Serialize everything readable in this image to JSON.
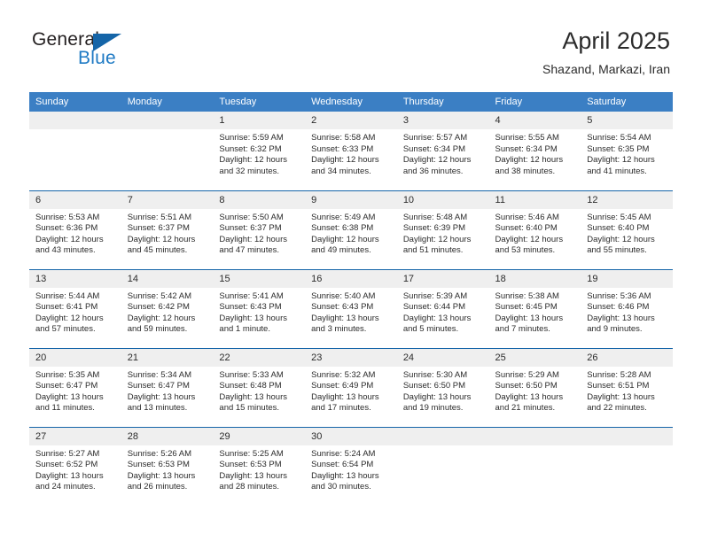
{
  "brand": {
    "name_part1": "General",
    "name_part2": "Blue",
    "triangle_color": "#1565a8",
    "blue_color": "#1f7ac4"
  },
  "header": {
    "title": "April 2025",
    "subtitle": "Shazand, Markazi, Iran"
  },
  "theme": {
    "header_row_bg": "#3b7fc4",
    "daynum_bg": "#efefef",
    "row_divider": "#1565a8",
    "text": "#2b2b2b"
  },
  "calendar": {
    "weekday_headers": [
      "Sunday",
      "Monday",
      "Tuesday",
      "Wednesday",
      "Thursday",
      "Friday",
      "Saturday"
    ],
    "weeks": [
      [
        {
          "day": "",
          "sunrise": "",
          "sunset": "",
          "daylight1": "",
          "daylight2": "",
          "blank": true
        },
        {
          "day": "",
          "sunrise": "",
          "sunset": "",
          "daylight1": "",
          "daylight2": "",
          "blank": true
        },
        {
          "day": "1",
          "sunrise": "Sunrise: 5:59 AM",
          "sunset": "Sunset: 6:32 PM",
          "daylight1": "Daylight: 12 hours",
          "daylight2": "and 32 minutes."
        },
        {
          "day": "2",
          "sunrise": "Sunrise: 5:58 AM",
          "sunset": "Sunset: 6:33 PM",
          "daylight1": "Daylight: 12 hours",
          "daylight2": "and 34 minutes."
        },
        {
          "day": "3",
          "sunrise": "Sunrise: 5:57 AM",
          "sunset": "Sunset: 6:34 PM",
          "daylight1": "Daylight: 12 hours",
          "daylight2": "and 36 minutes."
        },
        {
          "day": "4",
          "sunrise": "Sunrise: 5:55 AM",
          "sunset": "Sunset: 6:34 PM",
          "daylight1": "Daylight: 12 hours",
          "daylight2": "and 38 minutes."
        },
        {
          "day": "5",
          "sunrise": "Sunrise: 5:54 AM",
          "sunset": "Sunset: 6:35 PM",
          "daylight1": "Daylight: 12 hours",
          "daylight2": "and 41 minutes."
        }
      ],
      [
        {
          "day": "6",
          "sunrise": "Sunrise: 5:53 AM",
          "sunset": "Sunset: 6:36 PM",
          "daylight1": "Daylight: 12 hours",
          "daylight2": "and 43 minutes."
        },
        {
          "day": "7",
          "sunrise": "Sunrise: 5:51 AM",
          "sunset": "Sunset: 6:37 PM",
          "daylight1": "Daylight: 12 hours",
          "daylight2": "and 45 minutes."
        },
        {
          "day": "8",
          "sunrise": "Sunrise: 5:50 AM",
          "sunset": "Sunset: 6:37 PM",
          "daylight1": "Daylight: 12 hours",
          "daylight2": "and 47 minutes."
        },
        {
          "day": "9",
          "sunrise": "Sunrise: 5:49 AM",
          "sunset": "Sunset: 6:38 PM",
          "daylight1": "Daylight: 12 hours",
          "daylight2": "and 49 minutes."
        },
        {
          "day": "10",
          "sunrise": "Sunrise: 5:48 AM",
          "sunset": "Sunset: 6:39 PM",
          "daylight1": "Daylight: 12 hours",
          "daylight2": "and 51 minutes."
        },
        {
          "day": "11",
          "sunrise": "Sunrise: 5:46 AM",
          "sunset": "Sunset: 6:40 PM",
          "daylight1": "Daylight: 12 hours",
          "daylight2": "and 53 minutes."
        },
        {
          "day": "12",
          "sunrise": "Sunrise: 5:45 AM",
          "sunset": "Sunset: 6:40 PM",
          "daylight1": "Daylight: 12 hours",
          "daylight2": "and 55 minutes."
        }
      ],
      [
        {
          "day": "13",
          "sunrise": "Sunrise: 5:44 AM",
          "sunset": "Sunset: 6:41 PM",
          "daylight1": "Daylight: 12 hours",
          "daylight2": "and 57 minutes."
        },
        {
          "day": "14",
          "sunrise": "Sunrise: 5:42 AM",
          "sunset": "Sunset: 6:42 PM",
          "daylight1": "Daylight: 12 hours",
          "daylight2": "and 59 minutes."
        },
        {
          "day": "15",
          "sunrise": "Sunrise: 5:41 AM",
          "sunset": "Sunset: 6:43 PM",
          "daylight1": "Daylight: 13 hours",
          "daylight2": "and 1 minute."
        },
        {
          "day": "16",
          "sunrise": "Sunrise: 5:40 AM",
          "sunset": "Sunset: 6:43 PM",
          "daylight1": "Daylight: 13 hours",
          "daylight2": "and 3 minutes."
        },
        {
          "day": "17",
          "sunrise": "Sunrise: 5:39 AM",
          "sunset": "Sunset: 6:44 PM",
          "daylight1": "Daylight: 13 hours",
          "daylight2": "and 5 minutes."
        },
        {
          "day": "18",
          "sunrise": "Sunrise: 5:38 AM",
          "sunset": "Sunset: 6:45 PM",
          "daylight1": "Daylight: 13 hours",
          "daylight2": "and 7 minutes."
        },
        {
          "day": "19",
          "sunrise": "Sunrise: 5:36 AM",
          "sunset": "Sunset: 6:46 PM",
          "daylight1": "Daylight: 13 hours",
          "daylight2": "and 9 minutes."
        }
      ],
      [
        {
          "day": "20",
          "sunrise": "Sunrise: 5:35 AM",
          "sunset": "Sunset: 6:47 PM",
          "daylight1": "Daylight: 13 hours",
          "daylight2": "and 11 minutes."
        },
        {
          "day": "21",
          "sunrise": "Sunrise: 5:34 AM",
          "sunset": "Sunset: 6:47 PM",
          "daylight1": "Daylight: 13 hours",
          "daylight2": "and 13 minutes."
        },
        {
          "day": "22",
          "sunrise": "Sunrise: 5:33 AM",
          "sunset": "Sunset: 6:48 PM",
          "daylight1": "Daylight: 13 hours",
          "daylight2": "and 15 minutes."
        },
        {
          "day": "23",
          "sunrise": "Sunrise: 5:32 AM",
          "sunset": "Sunset: 6:49 PM",
          "daylight1": "Daylight: 13 hours",
          "daylight2": "and 17 minutes."
        },
        {
          "day": "24",
          "sunrise": "Sunrise: 5:30 AM",
          "sunset": "Sunset: 6:50 PM",
          "daylight1": "Daylight: 13 hours",
          "daylight2": "and 19 minutes."
        },
        {
          "day": "25",
          "sunrise": "Sunrise: 5:29 AM",
          "sunset": "Sunset: 6:50 PM",
          "daylight1": "Daylight: 13 hours",
          "daylight2": "and 21 minutes."
        },
        {
          "day": "26",
          "sunrise": "Sunrise: 5:28 AM",
          "sunset": "Sunset: 6:51 PM",
          "daylight1": "Daylight: 13 hours",
          "daylight2": "and 22 minutes."
        }
      ],
      [
        {
          "day": "27",
          "sunrise": "Sunrise: 5:27 AM",
          "sunset": "Sunset: 6:52 PM",
          "daylight1": "Daylight: 13 hours",
          "daylight2": "and 24 minutes."
        },
        {
          "day": "28",
          "sunrise": "Sunrise: 5:26 AM",
          "sunset": "Sunset: 6:53 PM",
          "daylight1": "Daylight: 13 hours",
          "daylight2": "and 26 minutes."
        },
        {
          "day": "29",
          "sunrise": "Sunrise: 5:25 AM",
          "sunset": "Sunset: 6:53 PM",
          "daylight1": "Daylight: 13 hours",
          "daylight2": "and 28 minutes."
        },
        {
          "day": "30",
          "sunrise": "Sunrise: 5:24 AM",
          "sunset": "Sunset: 6:54 PM",
          "daylight1": "Daylight: 13 hours",
          "daylight2": "and 30 minutes."
        },
        {
          "day": "",
          "sunrise": "",
          "sunset": "",
          "daylight1": "",
          "daylight2": "",
          "blank": true
        },
        {
          "day": "",
          "sunrise": "",
          "sunset": "",
          "daylight1": "",
          "daylight2": "",
          "blank": true
        },
        {
          "day": "",
          "sunrise": "",
          "sunset": "",
          "daylight1": "",
          "daylight2": "",
          "blank": true
        }
      ]
    ]
  }
}
